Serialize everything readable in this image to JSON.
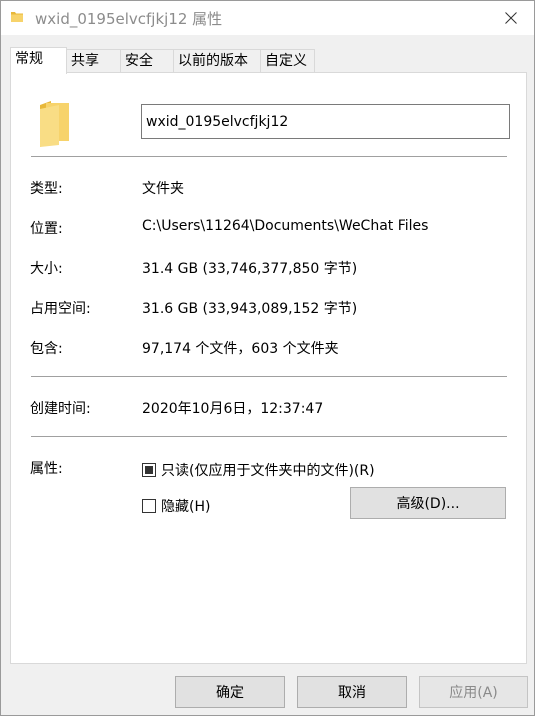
{
  "window": {
    "title": "wxid_0195elvcfjkj12 属性",
    "close_glyph": "✕"
  },
  "tabs": [
    {
      "label": "常规",
      "active": true
    },
    {
      "label": "共享",
      "active": false
    },
    {
      "label": "安全",
      "active": false
    },
    {
      "label": "以前的版本",
      "active": false
    },
    {
      "label": "自定义",
      "active": false
    }
  ],
  "general": {
    "folder_name": "wxid_0195elvcfjkj12",
    "rows": {
      "type": {
        "label": "类型:",
        "value": "文件夹"
      },
      "location": {
        "label": "位置:",
        "value": "C:\\Users\\11264\\Documents\\WeChat Files"
      },
      "size": {
        "label": "大小:",
        "value": "31.4 GB (33,746,377,850 字节)"
      },
      "size_on_disk": {
        "label": "占用空间:",
        "value": "31.6 GB (33,943,089,152 字节)"
      },
      "contains": {
        "label": "包含:",
        "value": "97,174 个文件，603 个文件夹"
      },
      "created": {
        "label": "创建时间:",
        "value": "2020年10月6日，12:37:47"
      }
    },
    "attributes": {
      "label": "属性:",
      "readonly": {
        "label": "只读(仅应用于文件夹中的文件)(R)",
        "state": "mixed"
      },
      "hidden": {
        "label": "隐藏(H)",
        "state": "unchecked"
      },
      "advanced_button": "高级(D)..."
    }
  },
  "footer": {
    "ok": "确定",
    "cancel": "取消",
    "apply": "应用(A)"
  },
  "colors": {
    "folder_yellow": "#f7d36b",
    "folder_dark": "#e8b83a",
    "title_gray": "#8c8c8c"
  }
}
